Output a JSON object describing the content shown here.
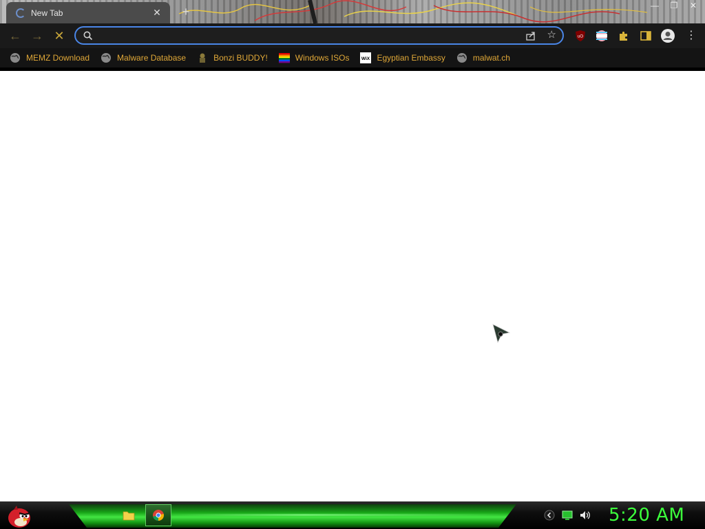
{
  "browser": {
    "tab": {
      "title": "New Tab",
      "close_icon": "close-icon",
      "loading_icon": "loading-spinner-icon"
    },
    "new_tab_icon": "plus-icon",
    "window_controls": [
      "minimize-icon",
      "restore-icon",
      "close-icon"
    ],
    "toolbar": {
      "back_icon": "arrow-left-icon",
      "forward_icon": "arrow-right-icon",
      "stop_icon": "stop-x-icon",
      "omnibox": {
        "value": "",
        "placeholder": "",
        "search_icon": "search-icon",
        "share_icon": "share-icon",
        "bookmark_icon": "star-icon"
      },
      "extensions": [
        "ublock-origin-icon",
        "flag-icon",
        "puzzle-icon",
        "side-panel-icon",
        "profile-avatar-icon",
        "kebab-menu-icon"
      ]
    },
    "bookmarks": [
      {
        "label": "MEMZ Download",
        "icon": "globe-icon"
      },
      {
        "label": "Malware Database",
        "icon": "globe-icon"
      },
      {
        "label": "Bonzi BUDDY!",
        "icon": "bonzi-icon"
      },
      {
        "label": "Windows ISOs",
        "icon": "rainbow-flag-icon"
      },
      {
        "label": "Egyptian Embassy",
        "icon": "wix-icon"
      },
      {
        "label": "malwat.ch",
        "icon": "globe-icon"
      }
    ],
    "accent_color": "#4a86e8",
    "bookmark_text_color": "#e0a838"
  },
  "taskbar": {
    "start_icon": "angry-bird-start-icon",
    "apps": [
      {
        "name": "file-explorer",
        "icon": "folder-icon",
        "active": false
      },
      {
        "name": "chrome",
        "icon": "chrome-icon",
        "active": true
      }
    ],
    "tray": [
      "chevron-left-icon",
      "monitor-icon",
      "volume-icon"
    ],
    "clock": "5:20 AM",
    "clock_color": "#3cff3c"
  }
}
